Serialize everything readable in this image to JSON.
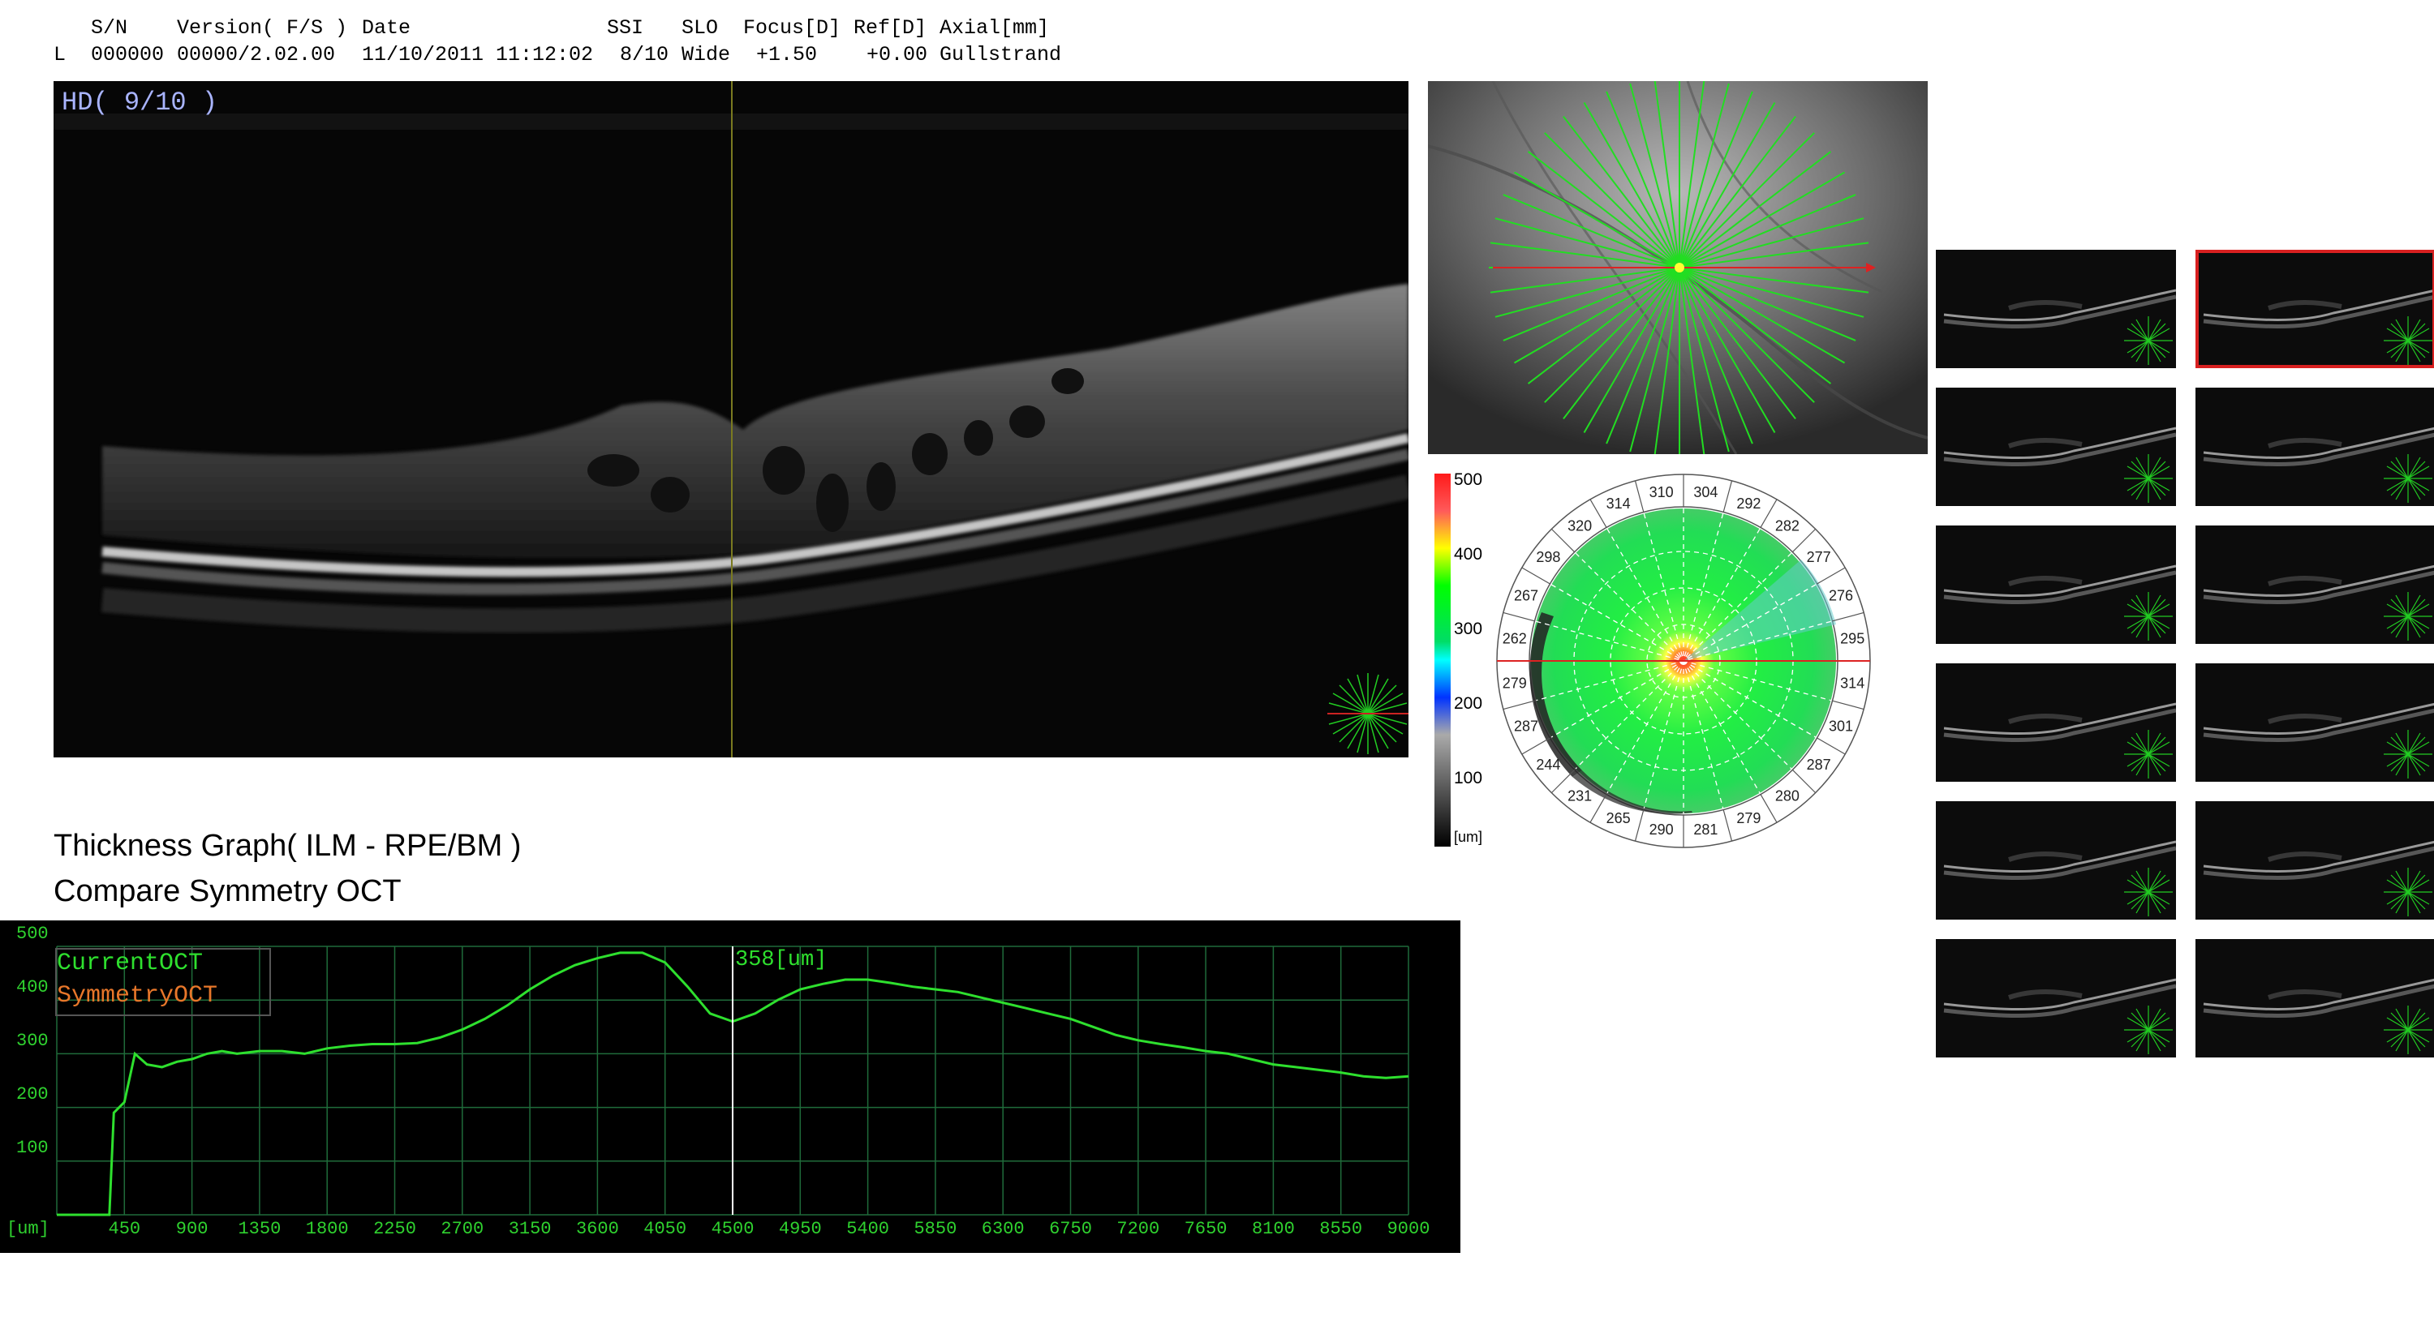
{
  "header": {
    "col_sn": "S/N",
    "col_version": "Version( F/S )",
    "col_date": "Date",
    "col_ssi": "SSI",
    "col_slo": "SLO",
    "col_focus": "Focus[D]",
    "col_ref": "Ref[D]",
    "col_axial": "Axial[mm]",
    "eye": "L",
    "sn": "000000",
    "version": "00000/2.02.00",
    "date": "11/10/2011 11:12:02",
    "ssi": "8/10",
    "slo": "Wide",
    "focus": "+1.50",
    "ref": "+0.00",
    "axial": "Gullstrand"
  },
  "bscan": {
    "quality_label": "HD( 9/10 )"
  },
  "colorbar": {
    "labels": [
      "500",
      "400",
      "300",
      "200",
      "100",
      "[um]"
    ],
    "colors": [
      "#ff1a1a",
      "#ffff00",
      "#00ff00",
      "#00ffff",
      "#0033ff",
      "#111111"
    ]
  },
  "polar_map": {
    "outer_ring": [
      "304",
      "292",
      "282",
      "277",
      "276",
      "295",
      "314",
      "301",
      "287",
      "280",
      "279",
      "281",
      "290",
      "265",
      "231",
      "244",
      "287",
      "279",
      "262",
      "267",
      "298",
      "320",
      "314",
      "310"
    ]
  },
  "thickness_graph": {
    "title": "Thickness Graph( ILM - RPE/BM )",
    "subtitle": "Compare Symmetry OCT",
    "legend_current": "CurrentOCT",
    "legend_symmetry": "SymmetryOCT",
    "cursor_value": "358[um]",
    "x_unit": "[um]",
    "y_ticks": [
      "500",
      "400",
      "300",
      "200",
      "100"
    ],
    "x_ticks": [
      "450",
      "900",
      "1350",
      "1800",
      "2250",
      "2700",
      "3150",
      "3600",
      "4050",
      "4500",
      "4950",
      "5400",
      "5850",
      "6300",
      "6750",
      "7200",
      "7650",
      "8100",
      "8550",
      "9000"
    ],
    "colors": {
      "current": "#2ee02e",
      "symmetry": "#e8772a",
      "grid": "#1f6b3a"
    }
  },
  "chart_data": {
    "type": "line",
    "title": "Thickness Graph( ILM - RPE/BM )",
    "subtitle": "Compare Symmetry OCT",
    "xlabel": "[um]",
    "ylabel": "",
    "xlim": [
      0,
      9000
    ],
    "ylim": [
      0,
      500
    ],
    "grid": true,
    "legend": "top-left",
    "series": [
      {
        "name": "CurrentOCT",
        "x": [
          0,
          200,
          350,
          380,
          450,
          520,
          600,
          700,
          800,
          900,
          1000,
          1100,
          1200,
          1350,
          1500,
          1650,
          1800,
          1950,
          2100,
          2250,
          2400,
          2550,
          2700,
          2850,
          3000,
          3150,
          3300,
          3450,
          3600,
          3750,
          3900,
          4050,
          4200,
          4350,
          4500,
          4650,
          4800,
          4950,
          5100,
          5250,
          5400,
          5550,
          5700,
          5850,
          6000,
          6150,
          6300,
          6450,
          6600,
          6750,
          6900,
          7050,
          7200,
          7350,
          7500,
          7650,
          7800,
          7950,
          8100,
          8250,
          8400,
          8550,
          8700,
          8850,
          9000
        ],
        "values": [
          0,
          0,
          0,
          190,
          210,
          300,
          280,
          275,
          285,
          290,
          300,
          305,
          300,
          305,
          305,
          300,
          310,
          315,
          318,
          318,
          320,
          330,
          345,
          365,
          390,
          420,
          445,
          465,
          478,
          488,
          488,
          470,
          425,
          375,
          360,
          375,
          400,
          420,
          430,
          438,
          438,
          432,
          425,
          420,
          415,
          405,
          395,
          385,
          375,
          365,
          350,
          335,
          325,
          318,
          312,
          305,
          300,
          290,
          280,
          275,
          270,
          265,
          258,
          255,
          258
        ]
      }
    ],
    "cursor": {
      "x": 4500,
      "label": "358[um]"
    }
  },
  "thumbnails": {
    "count": 12,
    "selected_index": 1
  }
}
